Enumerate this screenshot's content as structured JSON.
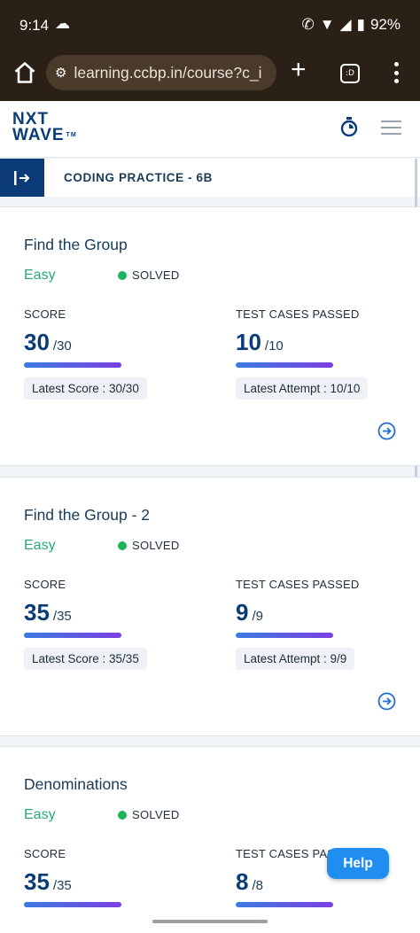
{
  "status_bar": {
    "time": "9:14",
    "battery": "92%"
  },
  "browser": {
    "url": "learning.ccbp.in/course?c_i",
    "tabs_label": ":D"
  },
  "app": {
    "logo_line1": "NXT",
    "logo_line2": "WAVE",
    "logo_tm": "TM"
  },
  "section": {
    "title": "CODING PRACTICE - 6B"
  },
  "cards": [
    {
      "title": "Find the Group",
      "difficulty": "Easy",
      "status": "SOLVED",
      "score_label": "SCORE",
      "score": "30",
      "score_total": "/30",
      "latest_score": "Latest Score : 30/30",
      "tests_label": "TEST CASES PASSED",
      "tests": "10",
      "tests_total": "/10",
      "latest_attempt": "Latest Attempt : 10/10"
    },
    {
      "title": "Find the Group - 2",
      "difficulty": "Easy",
      "status": "SOLVED",
      "score_label": "SCORE",
      "score": "35",
      "score_total": "/35",
      "latest_score": "Latest Score : 35/35",
      "tests_label": "TEST CASES PASSED",
      "tests": "9",
      "tests_total": "/9",
      "latest_attempt": "Latest Attempt : 9/9"
    },
    {
      "title": "Denominations",
      "difficulty": "Easy",
      "status": "SOLVED",
      "score_label": "SCORE",
      "score": "35",
      "score_total": "/35",
      "tests_label": "TEST CASES PASSED",
      "tests": "8",
      "tests_total": "/8"
    }
  ],
  "help": {
    "label": "Help"
  },
  "colors": {
    "brand": "#0b3c78",
    "easy": "#2aa873",
    "solved_dot": "#18b35c",
    "help": "#1f8ef0"
  }
}
